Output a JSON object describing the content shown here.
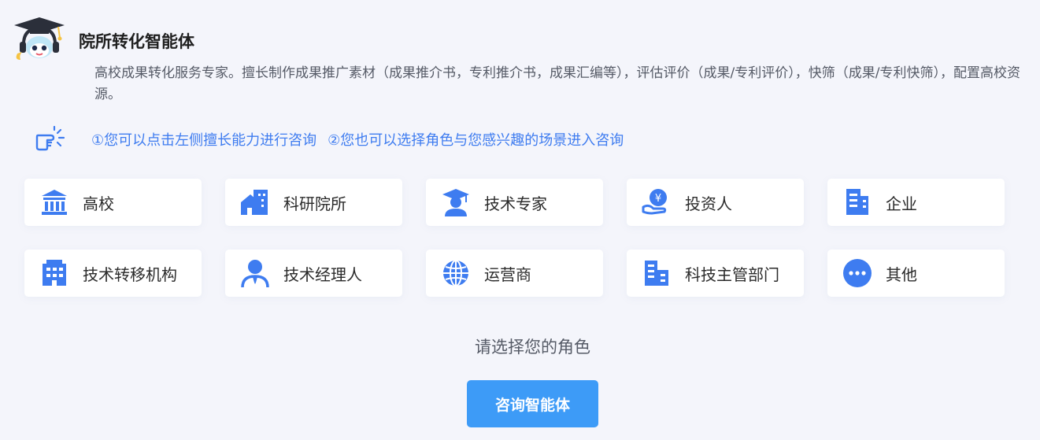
{
  "agent": {
    "title": "院所转化智能体",
    "description": "高校成果转化服务专家。擅长制作成果推广素材（成果推介书，专利推介书，成果汇编等），评估评价（成果/专利评价），快筛（成果/专利快筛），配置高校资源。"
  },
  "hint": {
    "icon": "pointing-hand-icon",
    "tip1": "①您可以点击左侧擅长能力进行咨询",
    "tip2": "②您也可以选择角色与您感兴趣的场景进入咨询"
  },
  "roles": [
    {
      "label": "高校",
      "icon": "university-icon"
    },
    {
      "label": "科研院所",
      "icon": "research-institute-icon"
    },
    {
      "label": "技术专家",
      "icon": "expert-icon"
    },
    {
      "label": "投资人",
      "icon": "investor-icon"
    },
    {
      "label": "企业",
      "icon": "enterprise-icon"
    },
    {
      "label": "技术转移机构",
      "icon": "transfer-agency-icon"
    },
    {
      "label": "技术经理人",
      "icon": "manager-icon"
    },
    {
      "label": "运营商",
      "icon": "globe-icon"
    },
    {
      "label": "科技主管部门",
      "icon": "government-icon"
    },
    {
      "label": "其他",
      "icon": "more-icon"
    }
  ],
  "prompt": "请选择您的角色",
  "consult_button": "咨询智能体",
  "colors": {
    "accent": "#3e7cf0",
    "button": "#3d9bf7",
    "background": "#f4f5fb"
  }
}
